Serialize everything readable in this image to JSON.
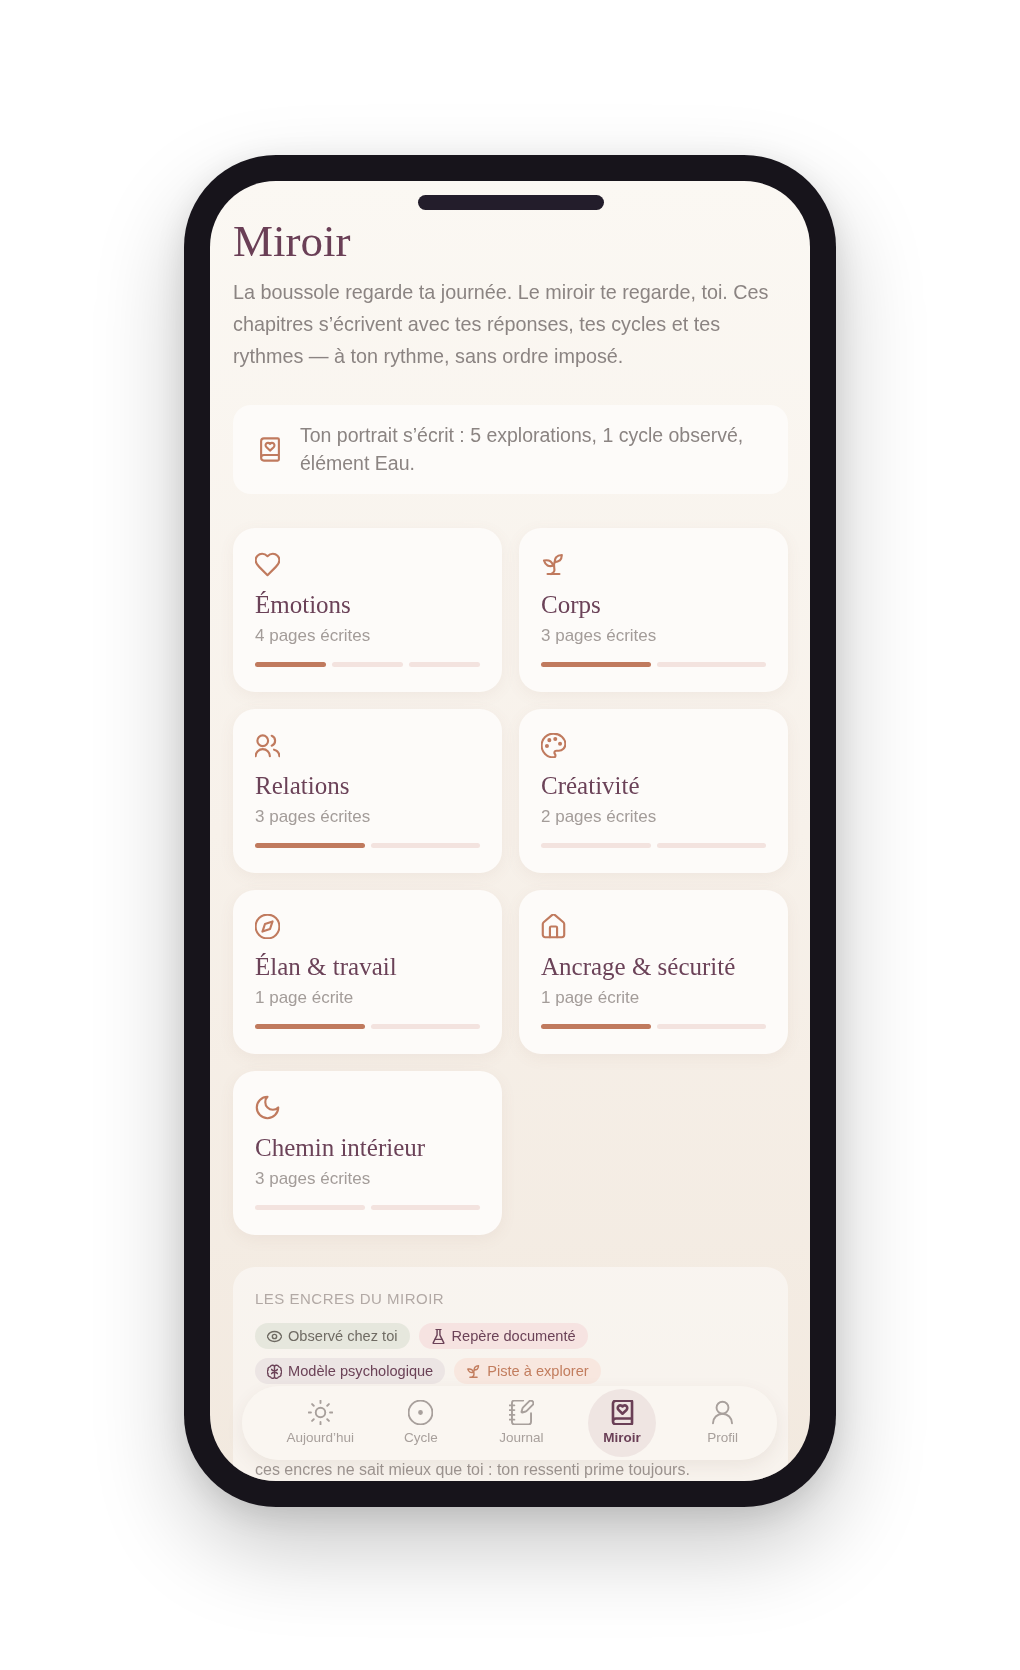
{
  "screen": {
    "title": "Miroir",
    "intro": "La boussole regarde ta journée. Le miroir te regarde, toi. Ces chapitres s’écrivent avec tes réponses, tes cycles et tes rythmes — à ton rythme, sans ordre imposé."
  },
  "summary": {
    "text": "Ton portrait s’écrit : 5 explorations, 1 cycle observé, élément Eau."
  },
  "chapters": [
    {
      "title": "Émotions",
      "pages": "4 pages écrites",
      "segments": [
        {
          "filled": true
        },
        {
          "filled": false
        },
        {
          "filled": false
        }
      ]
    },
    {
      "title": "Corps",
      "pages": "3 pages écrites",
      "segments": [
        {
          "filled": true
        },
        {
          "filled": false
        }
      ]
    },
    {
      "title": "Relations",
      "pages": "3 pages écrites",
      "segments": [
        {
          "filled": true
        },
        {
          "filled": false
        }
      ]
    },
    {
      "title": "Créativité",
      "pages": "2 pages écrites",
      "segments": [
        {
          "filled": false
        },
        {
          "filled": false
        }
      ]
    },
    {
      "title": "Élan & travail",
      "pages": "1 page écrite",
      "segments": [
        {
          "filled": true
        },
        {
          "filled": false
        }
      ]
    },
    {
      "title": "Ancrage & sécurité",
      "pages": "1 page écrite",
      "segments": [
        {
          "filled": true
        },
        {
          "filled": false
        }
      ]
    },
    {
      "title": "Chemin intérieur",
      "pages": "3 pages écrites",
      "segments": [
        {
          "filled": false
        },
        {
          "filled": false
        }
      ]
    }
  ],
  "legend": {
    "heading": "LES ENCRES DU MIROIR",
    "tags": [
      {
        "label": "Observé chez toi",
        "kind": "observed",
        "color": "#e6e7dd"
      },
      {
        "label": "Repère documenté",
        "kind": "documented",
        "color": "#f6e3e1"
      },
      {
        "label": "Modèle psychologique",
        "kind": "model",
        "color": "#ece5e4"
      },
      {
        "label": "Piste à explorer",
        "kind": "explore",
        "color": "#f8e7df"
      }
    ],
    "note": "ces encres ne sait mieux que toi : ton ressenti prime toujours."
  },
  "nav": [
    {
      "label": "Aujourd’hui",
      "selected": false
    },
    {
      "label": "Cycle",
      "selected": false
    },
    {
      "label": "Journal",
      "selected": false
    },
    {
      "label": "Miroir",
      "selected": true
    },
    {
      "label": "Profil",
      "selected": false
    }
  ]
}
